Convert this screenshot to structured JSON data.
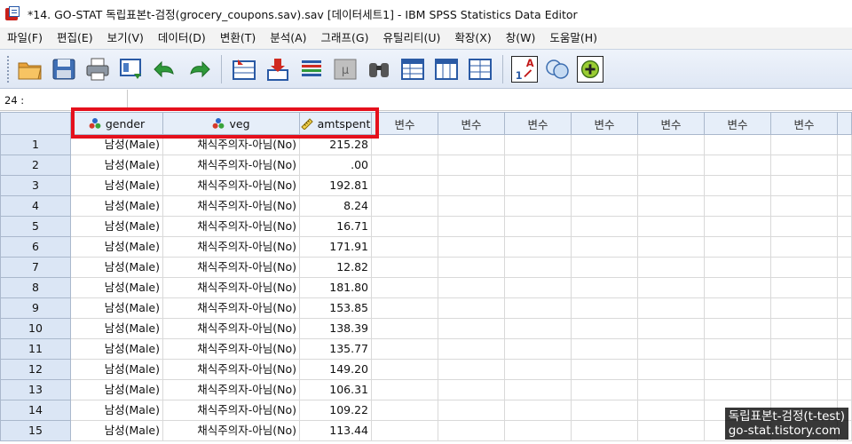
{
  "window": {
    "title": "*14. GO-STAT 독립표본t-검정(grocery_coupons.sav).sav [데이터세트1] - IBM SPSS Statistics Data Editor"
  },
  "menu": [
    {
      "label": "파일(F)"
    },
    {
      "label": "편집(E)"
    },
    {
      "label": "보기(V)"
    },
    {
      "label": "데이터(D)"
    },
    {
      "label": "변환(T)"
    },
    {
      "label": "분석(A)"
    },
    {
      "label": "그래프(G)"
    },
    {
      "label": "유틸리티(U)"
    },
    {
      "label": "확장(X)"
    },
    {
      "label": "창(W)"
    },
    {
      "label": "도움말(H)"
    }
  ],
  "toolbar": {
    "icons": [
      "open-folder-icon",
      "save-icon",
      "print-icon",
      "dialog-recall-icon",
      "undo-icon",
      "redo-icon",
      "goto-case-icon",
      "goto-variable-icon",
      "variables-icon",
      "run-descriptive-icon",
      "find-icon",
      "insert-cases-icon",
      "insert-variable-icon",
      "split-file-icon",
      "weight-cases-icon",
      "select-cases-icon",
      "value-labels-icon",
      "use-sets-icon"
    ]
  },
  "cell_ref": {
    "label": "24 :",
    "value": ""
  },
  "grid": {
    "columns": [
      {
        "name": "gender",
        "type": "nominal"
      },
      {
        "name": "veg",
        "type": "nominal"
      },
      {
        "name": "amtspent",
        "type": "scale"
      }
    ],
    "empty_col_label": "변수",
    "empty_cols": [
      "변수",
      "변수",
      "변수",
      "변수",
      "변수",
      "변수",
      "변수"
    ],
    "rows": [
      {
        "n": "1",
        "gender": "남성(Male)",
        "veg": "채식주의자-아님(No)",
        "amtspent": "215.28"
      },
      {
        "n": "2",
        "gender": "남성(Male)",
        "veg": "채식주의자-아님(No)",
        "amtspent": ".00"
      },
      {
        "n": "3",
        "gender": "남성(Male)",
        "veg": "채식주의자-아님(No)",
        "amtspent": "192.81"
      },
      {
        "n": "4",
        "gender": "남성(Male)",
        "veg": "채식주의자-아님(No)",
        "amtspent": "8.24"
      },
      {
        "n": "5",
        "gender": "남성(Male)",
        "veg": "채식주의자-아님(No)",
        "amtspent": "16.71"
      },
      {
        "n": "6",
        "gender": "남성(Male)",
        "veg": "채식주의자-아님(No)",
        "amtspent": "171.91"
      },
      {
        "n": "7",
        "gender": "남성(Male)",
        "veg": "채식주의자-아님(No)",
        "amtspent": "12.82"
      },
      {
        "n": "8",
        "gender": "남성(Male)",
        "veg": "채식주의자-아님(No)",
        "amtspent": "181.80"
      },
      {
        "n": "9",
        "gender": "남성(Male)",
        "veg": "채식주의자-아님(No)",
        "amtspent": "153.85"
      },
      {
        "n": "10",
        "gender": "남성(Male)",
        "veg": "채식주의자-아님(No)",
        "amtspent": "138.39"
      },
      {
        "n": "11",
        "gender": "남성(Male)",
        "veg": "채식주의자-아님(No)",
        "amtspent": "135.77"
      },
      {
        "n": "12",
        "gender": "남성(Male)",
        "veg": "채식주의자-아님(No)",
        "amtspent": "149.20"
      },
      {
        "n": "13",
        "gender": "남성(Male)",
        "veg": "채식주의자-아님(No)",
        "amtspent": "106.31"
      },
      {
        "n": "14",
        "gender": "남성(Male)",
        "veg": "채식주의자-아님(No)",
        "amtspent": "109.22"
      },
      {
        "n": "15",
        "gender": "남성(Male)",
        "veg": "채식주의자-아님(No)",
        "amtspent": "113.44"
      }
    ]
  },
  "watermark": {
    "line1": "독립표본t-검정(t-test)",
    "line2": "go-stat.tistory.com"
  },
  "colors": {
    "highlight": "#e5101c",
    "header_bg": "#e6eef9",
    "rownum_bg": "#dbe6f5"
  }
}
